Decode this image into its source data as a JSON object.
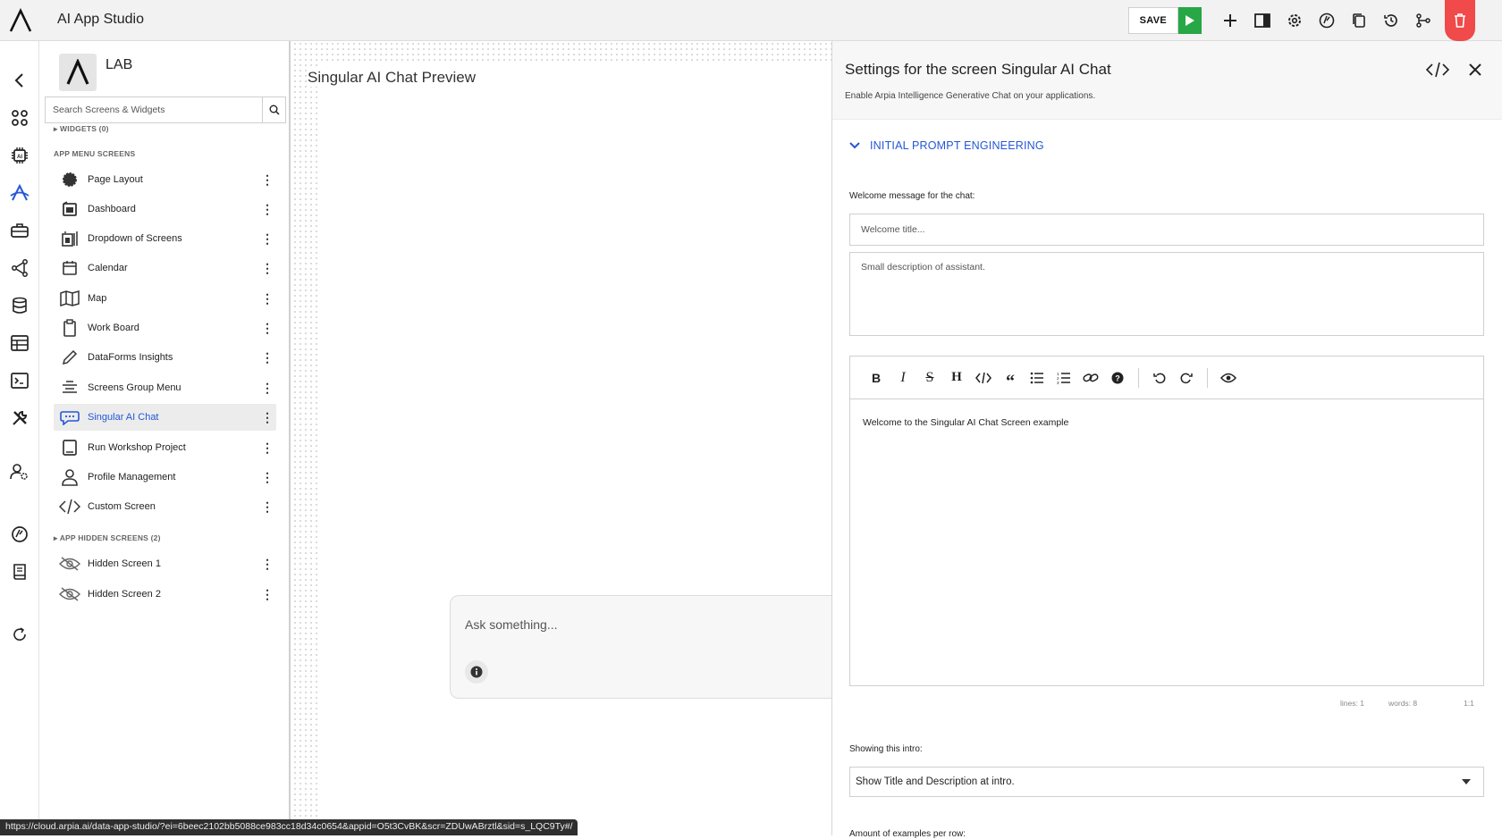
{
  "app": {
    "title": "AI App Studio"
  },
  "toolbar": {
    "save_label": "SAVE",
    "icons": [
      "play-icon",
      "plus-icon",
      "panel-icon",
      "gear-icon",
      "dashboard-icon",
      "copy-icon",
      "history-icon",
      "branch-icon",
      "trash-icon"
    ]
  },
  "rail": {
    "icons": [
      "back-icon",
      "apps-icon",
      "chip-icon",
      "studio-icon",
      "toolbox-icon",
      "network-icon",
      "database-icon",
      "table-icon",
      "terminal-icon",
      "tools-icon",
      "user-settings-icon",
      "gauge-icon",
      "book-icon",
      "refresh-icon"
    ]
  },
  "sidebar": {
    "lab_title": "LAB",
    "search_placeholder": "Search Screens & Widgets",
    "widgets_header": "WIDGETS (0)",
    "menu_header": "APP MENU SCREENS",
    "items": [
      {
        "label": "Page Layout",
        "icon": "gear-badge-icon"
      },
      {
        "label": "Dashboard",
        "icon": "dashboard-icon"
      },
      {
        "label": "Dropdown of Screens",
        "icon": "dropdown-icon"
      },
      {
        "label": "Calendar",
        "icon": "calendar-icon"
      },
      {
        "label": "Map",
        "icon": "map-icon"
      },
      {
        "label": "Work Board",
        "icon": "clipboard-icon"
      },
      {
        "label": "DataForms Insights",
        "icon": "pencil-icon"
      },
      {
        "label": "Screens Group Menu",
        "icon": "menu-lines-icon"
      },
      {
        "label": "Singular AI Chat",
        "icon": "chat-icon",
        "active": true
      },
      {
        "label": "Run Workshop Project",
        "icon": "tablet-icon"
      },
      {
        "label": "Profile Management",
        "icon": "user-icon"
      },
      {
        "label": "Custom Screen",
        "icon": "code-icon"
      }
    ],
    "hidden_header": "APP HIDDEN SCREENS (2)",
    "hidden_items": [
      {
        "label": "Hidden Screen 1",
        "icon": "eye-off-icon"
      },
      {
        "label": "Hidden Screen 2",
        "icon": "eye-off-icon"
      }
    ]
  },
  "canvas": {
    "preview_title": "Singular AI Chat Preview",
    "chat_placeholder": "Ask something..."
  },
  "panel": {
    "title": "Settings for the screen Singular AI Chat",
    "subtitle": "Enable Arpia Intelligence Generative Chat on your applications.",
    "section_title": "INITIAL PROMPT ENGINEERING",
    "welcome_label": "Welcome message for the chat:",
    "welcome_title_placeholder": "Welcome title...",
    "description_placeholder": "Small description of assistant.",
    "editor_text": "Welcome to the Singular AI Chat Screen example",
    "editor_status": {
      "lines": "lines: 1",
      "words": "words: 8",
      "cursor": "1:1"
    },
    "intro_label": "Showing this intro:",
    "intro_value": "Show Title and Description at intro.",
    "examples_label": "Amount of examples per row:"
  },
  "statusbar": {
    "url": "https://cloud.arpia.ai/data-app-studio/?ei=6beec2102bb5088ce983cc18d34c0654&appid=O5t3CvBK&scr=ZDUwABrztl&sid=s_LQC9Ty#/"
  },
  "colors": {
    "accent": "#2457d6",
    "play": "#27a745",
    "delete": "#f04a4a"
  }
}
